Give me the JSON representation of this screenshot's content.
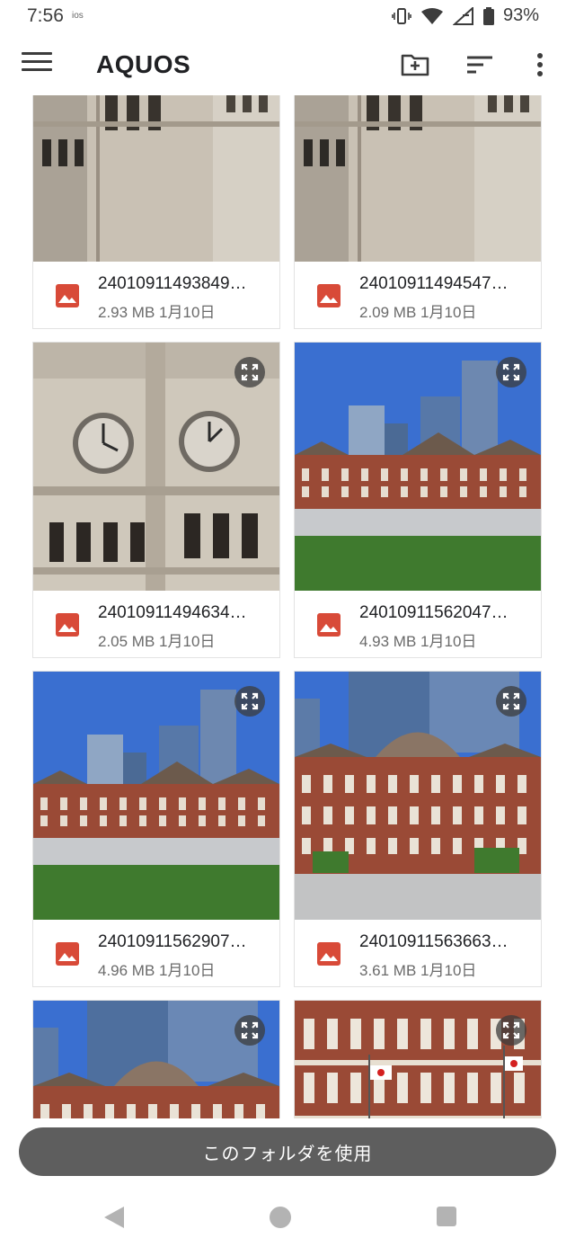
{
  "status_bar": {
    "time": "7:56",
    "carrier_tag": "ios",
    "battery": "93%"
  },
  "app_bar": {
    "title": "AQUOS",
    "icons": [
      "menu-icon",
      "new-folder-icon",
      "sort-icon",
      "more-vert-icon"
    ]
  },
  "files": [
    {
      "name": "24010911493849…",
      "size": "2.93 MB",
      "date": "1月10日",
      "scene": "tower-bottom"
    },
    {
      "name": "24010911494547…",
      "size": "2.09 MB",
      "date": "1月10日",
      "scene": "tower-bottom"
    },
    {
      "name": "24010911494634…",
      "size": "2.05 MB",
      "date": "1月10日",
      "scene": "clock-tower"
    },
    {
      "name": "24010911562047…",
      "size": "4.93 MB",
      "date": "1月10日",
      "scene": "station-wide"
    },
    {
      "name": "24010911562907…",
      "size": "4.96 MB",
      "date": "1月10日",
      "scene": "station-wide"
    },
    {
      "name": "24010911563663…",
      "size": "3.61 MB",
      "date": "1月10日",
      "scene": "station-front"
    },
    {
      "scene": "station-front"
    },
    {
      "scene": "station-close"
    }
  ],
  "bottom_button": {
    "label": "このフォルダを使用"
  },
  "colors": {
    "accent_red": "#d84a38",
    "button_gray": "#5e5e5e",
    "sky": "#3a6fd0",
    "brick": "#9a4a36",
    "stone": "#b8aea0"
  }
}
